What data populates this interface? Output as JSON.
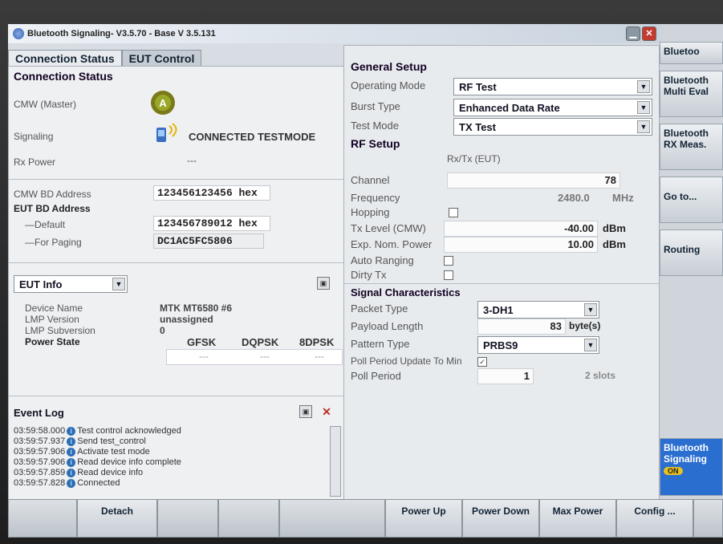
{
  "window": {
    "title": "Bluetooth Signaling",
    "version": " - V3.5.70 - Base V 3.5.131"
  },
  "tabs": [
    {
      "label": "Connection Status",
      "active": true
    },
    {
      "label": "EUT Control",
      "active": false
    }
  ],
  "left": {
    "title": "Connection Status",
    "cmw_label": "CMW (Master)",
    "signaling_label": "Signaling",
    "signaling_status": "CONNECTED TESTMODE",
    "rx_power_label": "Rx Power",
    "rx_power_value": "---",
    "cmw_bd_label": "CMW BD Address",
    "cmw_bd_value": "123456123456",
    "cmw_bd_unit": "hex",
    "eut_bd_label": "EUT BD Address",
    "default_label": "Default",
    "default_value": "123456789012",
    "default_unit": "hex",
    "paging_label": "For Paging",
    "paging_value": "DC1AC5FC5806",
    "eut_info_select": "EUT Info",
    "device_name_label": "Device Name",
    "device_name_value": "MTK MT6580 #6",
    "lmp_version_label": "LMP Version",
    "lmp_version_value": "unassigned",
    "lmp_sub_label": "LMP Subversion",
    "lmp_sub_value": "0",
    "power_state_label": "Power State",
    "col_gfsk": "GFSK",
    "col_dqpsk": "DQPSK",
    "col_8dpsk": "8DPSK",
    "gfsk_value": "---",
    "dqpsk_value": "---",
    "dpsk8_value": "---",
    "event_log_title": "Event Log",
    "log": [
      {
        "time": "03:59:58.000",
        "text": "Test control acknowledged"
      },
      {
        "time": "03:59:57.937",
        "text": "Send test_control"
      },
      {
        "time": "03:59:57.906",
        "text": "Activate test mode"
      },
      {
        "time": "03:59:57.906",
        "text": "Read device info complete"
      },
      {
        "time": "03:59:57.859",
        "text": "Read device info"
      },
      {
        "time": "03:59:57.828",
        "text": "Connected"
      }
    ]
  },
  "general": {
    "title": "General Setup",
    "op_mode_label": "Operating Mode",
    "op_mode_value": "RF Test",
    "burst_label": "Burst Type",
    "burst_value": "Enhanced Data Rate",
    "test_mode_label": "Test Mode",
    "test_mode_value": "TX Test"
  },
  "rf": {
    "title": "RF Setup",
    "subtitle": "Rx/Tx (EUT)",
    "channel_label": "Channel",
    "channel_value": "78",
    "freq_label": "Frequency",
    "freq_value": "2480.0",
    "freq_unit": "MHz",
    "hopping_label": "Hopping",
    "tx_level_label": "Tx Level (CMW)",
    "tx_level_value": "-40.00",
    "tx_level_unit": "dBm",
    "exp_nom_label": "Exp. Nom. Power",
    "exp_nom_value": "10.00",
    "exp_nom_unit": "dBm",
    "auto_ranging_label": "Auto Ranging",
    "dirty_tx_label": "Dirty Tx"
  },
  "signal": {
    "title": "Signal Characteristics",
    "packet_label": "Packet Type",
    "packet_value": "3-DH1",
    "payload_label": "Payload Length",
    "payload_value": "83",
    "payload_unit": "byte(s)",
    "pattern_label": "Pattern Type",
    "pattern_value": "PRBS9",
    "poll_update_label": "Poll Period Update To Min",
    "poll_label": "Poll Period",
    "poll_value": "1",
    "poll_unit": "2 slots"
  },
  "sidebar": {
    "top": "Bluetoo",
    "multi_eval": "Bluetooth Multi Eval",
    "rx_meas": "Bluetooth RX Meas.",
    "goto": "Go to...",
    "routing": "Routing",
    "signaling": "Bluetooth Signaling",
    "on": "ON"
  },
  "bottom": {
    "detach": "Detach",
    "power_up": "Power Up",
    "power_down": "Power Down",
    "max_power": "Max Power",
    "config": "Config ..."
  }
}
